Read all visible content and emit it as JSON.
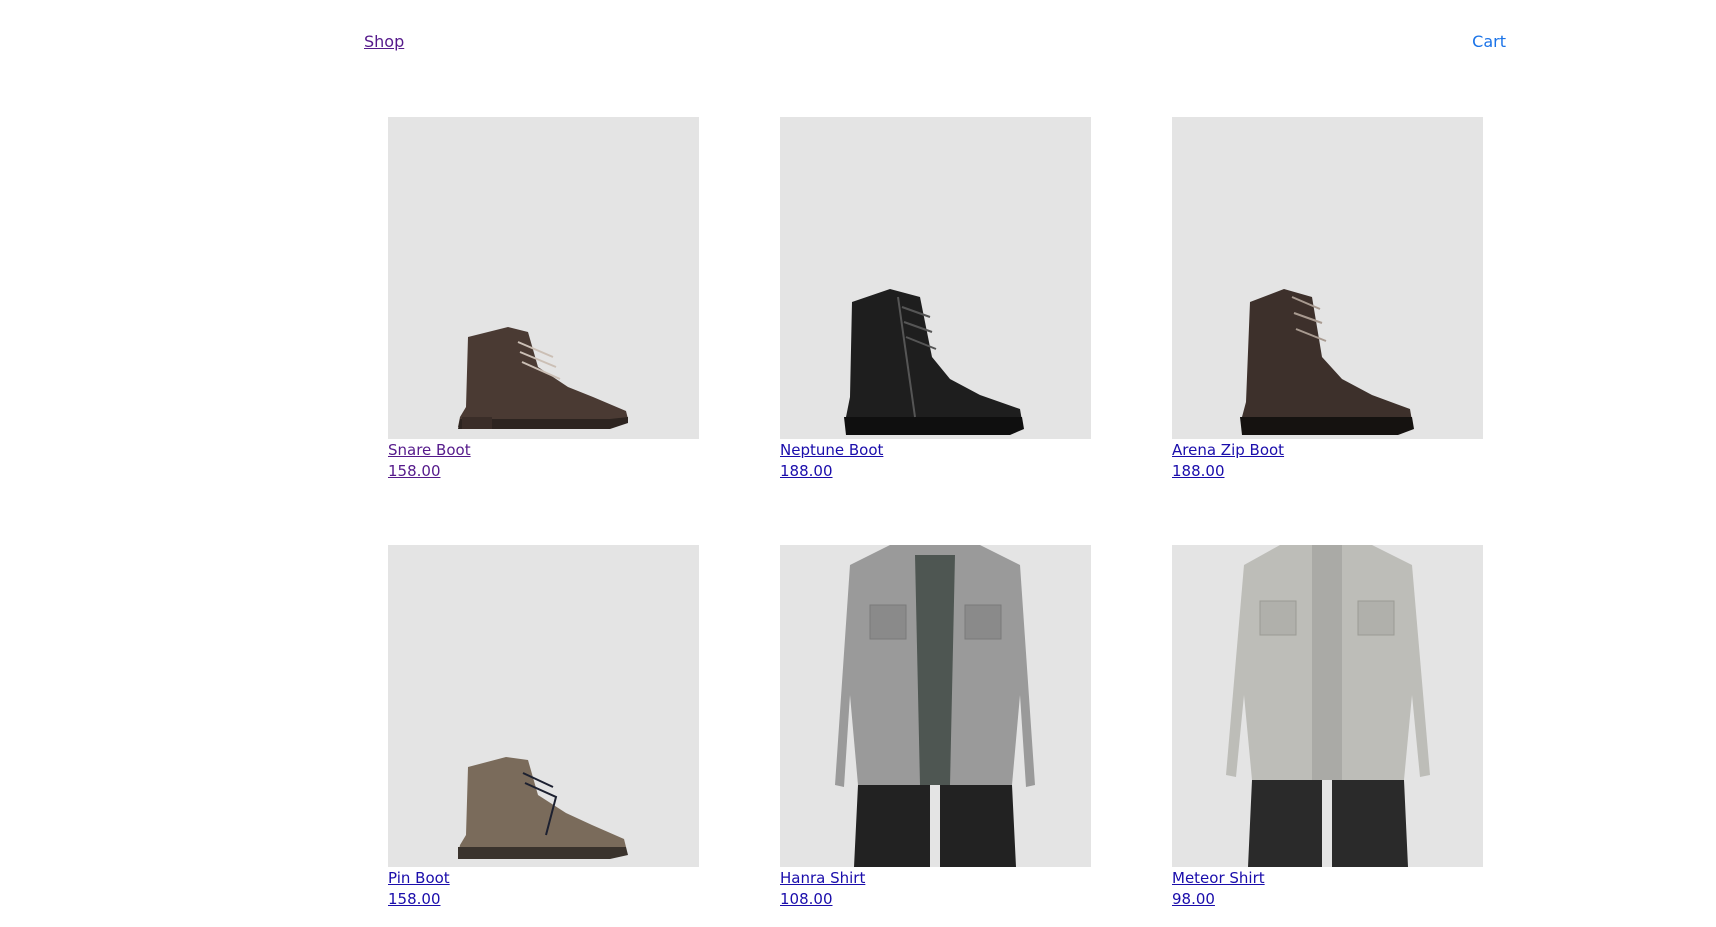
{
  "nav": {
    "shop_label": "Shop",
    "cart_label": "Cart"
  },
  "colors": {
    "visited_link": "#551a8b",
    "link": "#1a0dab",
    "cart_link": "#1a73e8",
    "image_bg": "#e4e4e4"
  },
  "products": [
    {
      "name": "Snare Boot",
      "price": "158.00",
      "image_icon": "brown-lace-up-boot-image"
    },
    {
      "name": "Neptune Boot",
      "price": "188.00",
      "image_icon": "black-combat-boot-image"
    },
    {
      "name": "Arena Zip Boot",
      "price": "188.00",
      "image_icon": "brown-zip-boot-image"
    },
    {
      "name": "Pin Boot",
      "price": "158.00",
      "image_icon": "suede-lace-boot-image"
    },
    {
      "name": "Hanra Shirt",
      "price": "108.00",
      "image_icon": "grey-denim-shirt-image"
    },
    {
      "name": "Meteor Shirt",
      "price": "98.00",
      "image_icon": "light-denim-shirt-image"
    }
  ]
}
